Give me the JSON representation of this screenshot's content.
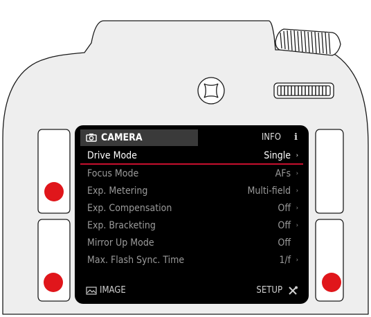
{
  "colors": {
    "body": "#eeeeee",
    "outline": "#1a1a1a",
    "screen": "#000000",
    "active_tab": "#3a3a3a",
    "highlight_line": "#c8102e",
    "indicator_dot": "#e0161b"
  },
  "icons": {
    "camera_tab": "camera-icon",
    "info_tab": "info-icon",
    "image_tab": "image-icon",
    "setup_tab": "wrench-screwdriver-icon",
    "submenu": "triangle-right-icon"
  },
  "tabs": {
    "camera": "CAMERA",
    "info": "INFO",
    "info_glyph": "i",
    "image": "IMAGE",
    "setup": "SETUP"
  },
  "menu": [
    {
      "label": "Drive Mode",
      "value": "Single",
      "arrow": "›",
      "selected": true
    },
    {
      "label": "Focus Mode",
      "value": "AFs",
      "arrow": "›"
    },
    {
      "label": "Exp. Metering",
      "value": "Multi-field",
      "arrow": "›"
    },
    {
      "label": "Exp. Compensation",
      "value": "Off",
      "arrow": "›"
    },
    {
      "label": "Exp. Bracketing",
      "value": "Off",
      "arrow": "›"
    },
    {
      "label": "Mirror Up Mode",
      "value": "Off",
      "arrow": ""
    },
    {
      "label": "Max. Flash Sync. Time",
      "value": "1/f",
      "arrow": "›"
    }
  ]
}
